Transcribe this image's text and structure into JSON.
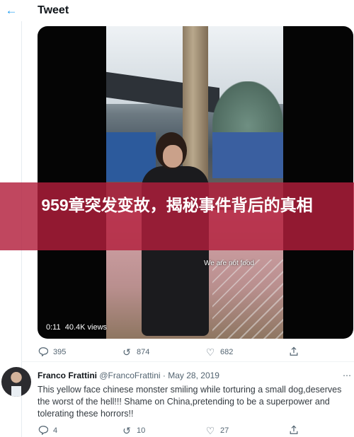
{
  "header": {
    "back_icon": "arrow-left-icon",
    "title": "Tweet"
  },
  "media": {
    "subtitle": "We are not food",
    "duration": "0:11",
    "views": "40.4K views"
  },
  "overlay": {
    "headline": "959章突发变故，揭秘事件背后的真相"
  },
  "main_actions": {
    "replies": "395",
    "retweets": "874",
    "likes": "682"
  },
  "reply": {
    "name": "Franco Frattini",
    "handle": "@FrancoFrattini",
    "separator": "·",
    "date": "May 28, 2019",
    "more_icon": "ellipsis-icon",
    "text": "This yellow face chinese monster smiling while torturing a small dog,deserves the worst of the hell!!!  Shame on China,pretending to be a superpower and tolerating these horrors!!",
    "actions": {
      "replies": "4",
      "retweets": "10",
      "likes": "27"
    }
  },
  "colors": {
    "accent": "#1d9bf0",
    "overlay": "#b21e3c",
    "muted": "#536471"
  }
}
